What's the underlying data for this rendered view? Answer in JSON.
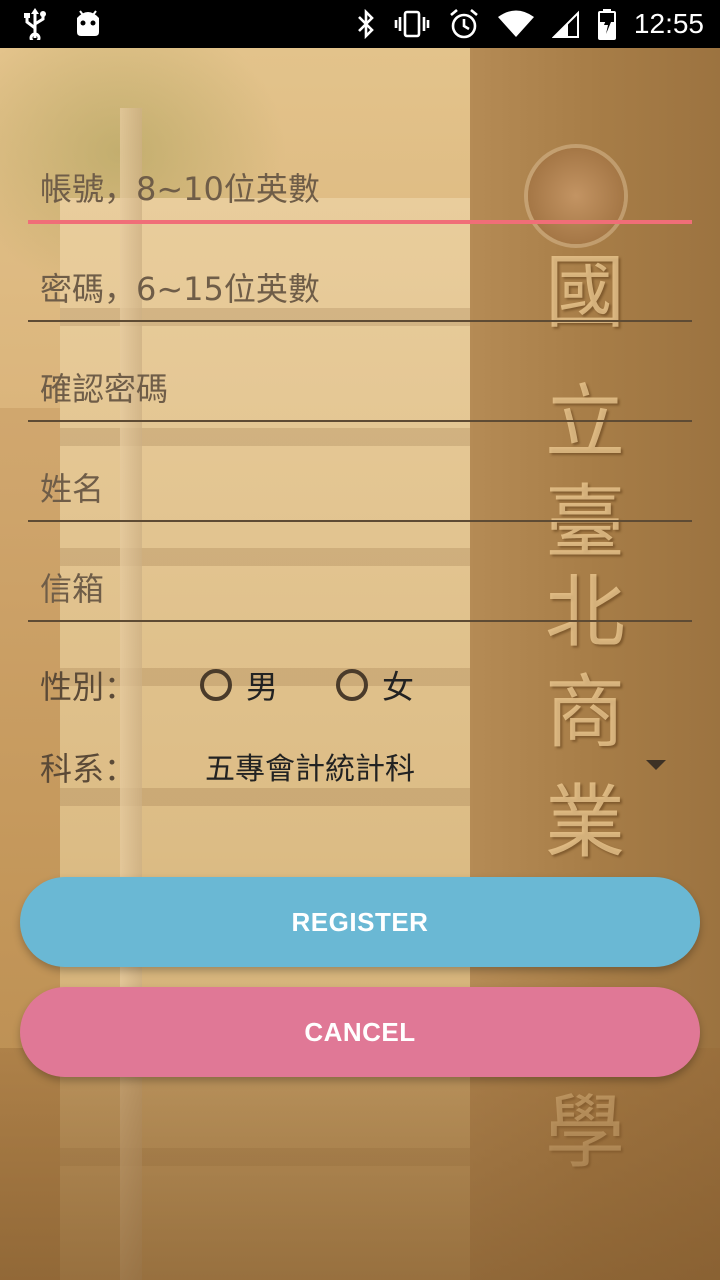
{
  "statusbar": {
    "time": "12:55",
    "left_icons": [
      "usb-icon",
      "android-debug-icon"
    ],
    "right_icons": [
      "bluetooth-icon",
      "vibrate-icon",
      "alarm-icon",
      "wifi-icon",
      "cell-signal-icon",
      "battery-icon"
    ]
  },
  "form": {
    "account_placeholder": "帳號，8~10位英數",
    "password_placeholder": "密碼，6~15位英數",
    "confirm_placeholder": "確認密碼",
    "name_placeholder": "姓名",
    "email_placeholder": "信箱",
    "gender_label": "性別：",
    "gender_options": [
      "男",
      "女"
    ],
    "department_label": "科系：",
    "department_selected": "五專會計統計科"
  },
  "buttons": {
    "register": "REGISTER",
    "cancel": "CANCEL"
  },
  "background": {
    "sign_characters": [
      "國",
      "立",
      "臺",
      "北",
      "商",
      "業",
      "學"
    ]
  },
  "colors": {
    "focus_underline": "#f06e78",
    "register_button": "#6ab8d4",
    "cancel_button": "#e07896"
  }
}
